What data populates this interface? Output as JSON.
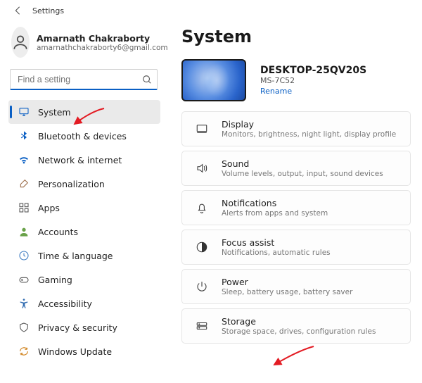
{
  "topbar": {
    "title": "Settings"
  },
  "profile": {
    "name": "Amarnath Chakraborty",
    "email": "amarnathchakraborty6@gmail.com"
  },
  "search": {
    "placeholder": "Find a setting"
  },
  "colors": {
    "accent": "#0a5fc4",
    "arrow": "#e31b23"
  },
  "sidebar": {
    "items": [
      {
        "label": "System",
        "icon": "monitor-icon",
        "selected": true,
        "icon_color": "#0a5fc4"
      },
      {
        "label": "Bluetooth & devices",
        "icon": "bluetooth-icon",
        "selected": false,
        "icon_color": "#0a5fc4"
      },
      {
        "label": "Network & internet",
        "icon": "wifi-icon",
        "selected": false,
        "icon_color": "#0a5fc4"
      },
      {
        "label": "Personalization",
        "icon": "brush-icon",
        "selected": false,
        "icon_color": "#9a6a46"
      },
      {
        "label": "Apps",
        "icon": "apps-icon",
        "selected": false,
        "icon_color": "#555555"
      },
      {
        "label": "Accounts",
        "icon": "person-icon",
        "selected": false,
        "icon_color": "#6aa24a"
      },
      {
        "label": "Time & language",
        "icon": "clock-icon",
        "selected": false,
        "icon_color": "#3a79c0"
      },
      {
        "label": "Gaming",
        "icon": "gaming-icon",
        "selected": false,
        "icon_color": "#555555"
      },
      {
        "label": "Accessibility",
        "icon": "accessibility-icon",
        "selected": false,
        "icon_color": "#2f6bb0"
      },
      {
        "label": "Privacy & security",
        "icon": "shield-icon",
        "selected": false,
        "icon_color": "#555555"
      },
      {
        "label": "Windows Update",
        "icon": "update-icon",
        "selected": false,
        "icon_color": "#d38a2a"
      }
    ]
  },
  "page": {
    "title": "System"
  },
  "device": {
    "name": "DESKTOP-25QV20S",
    "model": "MS-7C52",
    "rename_label": "Rename"
  },
  "settings": [
    {
      "icon": "display-icon",
      "title": "Display",
      "sub": "Monitors, brightness, night light, display profile"
    },
    {
      "icon": "sound-icon",
      "title": "Sound",
      "sub": "Volume levels, output, input, sound devices"
    },
    {
      "icon": "bell-icon",
      "title": "Notifications",
      "sub": "Alerts from apps and system"
    },
    {
      "icon": "focus-icon",
      "title": "Focus assist",
      "sub": "Notifications, automatic rules"
    },
    {
      "icon": "power-icon",
      "title": "Power",
      "sub": "Sleep, battery usage, battery saver"
    },
    {
      "icon": "storage-icon",
      "title": "Storage",
      "sub": "Storage space, drives, configuration rules"
    }
  ]
}
